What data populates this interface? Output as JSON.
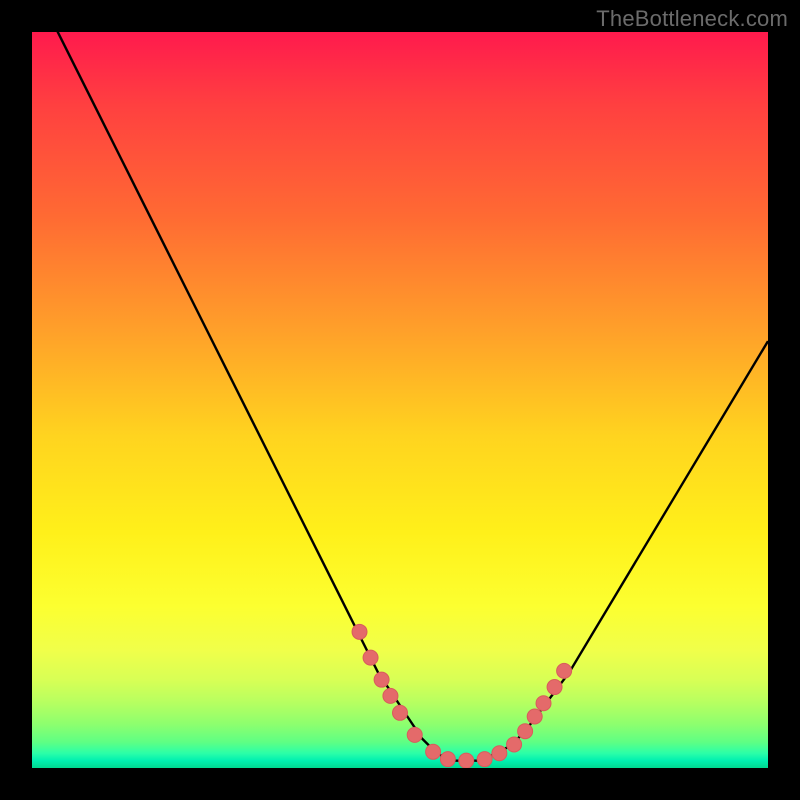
{
  "watermark": "TheBottleneck.com",
  "colors": {
    "frame": "#000000",
    "curve": "#000000",
    "marker": "#e46a6a",
    "marker_stroke": "#d85c5c"
  },
  "chart_data": {
    "type": "line",
    "title": "",
    "xlabel": "",
    "ylabel": "",
    "xlim": [
      0,
      100
    ],
    "ylim": [
      0,
      100
    ],
    "grid": false,
    "curve_note": "V-shaped bottleneck curve; y approximates percentage bottleneck, minimum near x≈58",
    "x": [
      0,
      3,
      6,
      9,
      12,
      15,
      18,
      21,
      24,
      27,
      30,
      33,
      36,
      39,
      42,
      45,
      47,
      49,
      51,
      53,
      55,
      57,
      59,
      61,
      63,
      65,
      67,
      70,
      73,
      76,
      79,
      82,
      85,
      88,
      91,
      94,
      97,
      100
    ],
    "y": [
      107,
      101,
      95,
      89,
      83,
      77,
      71,
      65,
      59,
      53,
      47,
      41,
      35,
      29,
      23,
      17,
      13,
      10,
      7,
      4,
      2,
      1,
      1,
      1,
      2,
      3,
      5,
      9,
      13,
      18,
      23,
      28,
      33,
      38,
      43,
      48,
      53,
      58
    ],
    "series": [
      {
        "name": "highlighted-points",
        "type": "scatter",
        "x": [
          44.5,
          46.0,
          47.5,
          48.7,
          50.0,
          52.0,
          54.5,
          56.5,
          59.0,
          61.5,
          63.5,
          65.5,
          67.0,
          68.3,
          69.5,
          71.0,
          72.3
        ],
        "y": [
          18.5,
          15.0,
          12.0,
          9.8,
          7.5,
          4.5,
          2.2,
          1.2,
          1.0,
          1.2,
          2.0,
          3.2,
          5.0,
          7.0,
          8.8,
          11.0,
          13.2
        ]
      }
    ]
  }
}
